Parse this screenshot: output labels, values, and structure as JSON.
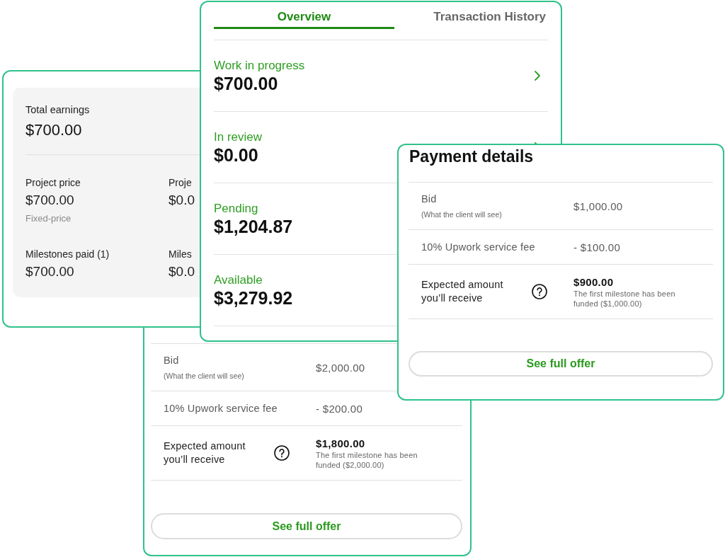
{
  "balance_card": {
    "tabs": [
      {
        "label": "Overview",
        "selected": true
      },
      {
        "label": "Transaction History",
        "selected": false
      }
    ],
    "rows": [
      {
        "label": "Work in progress",
        "amount": "$700.00"
      },
      {
        "label": "In review",
        "amount": "$0.00"
      },
      {
        "label": "Pending",
        "amount": "$1,204.87"
      },
      {
        "label": "Available",
        "amount": "$3,279.92"
      }
    ]
  },
  "earnings_card": {
    "total_label": "Total earnings",
    "total_amount": "$700.00",
    "stats": [
      {
        "label": "Project price",
        "amount": "$700.00",
        "note": "Fixed-price"
      },
      {
        "label": "Proje",
        "amount": "$0.0"
      },
      {
        "label": "Milestones paid (1)",
        "amount": "$700.00"
      },
      {
        "label": "Miles",
        "amount": "$0.0"
      }
    ]
  },
  "offer_cards": [
    {
      "title": "Payment details",
      "rows": [
        {
          "kind": "bid",
          "label": "Bid",
          "sublabel": "(What the client will see)",
          "value": "$1,000.00"
        },
        {
          "kind": "fee",
          "label": "10% Upwork service fee",
          "value": "- $100.00"
        },
        {
          "kind": "expected",
          "label": "Expected amount you’ll receive",
          "value": "$900.00",
          "note": "The first milestone has been funded ($1,000.00)"
        }
      ],
      "button": "See full offer"
    },
    {
      "rows": [
        {
          "kind": "bid",
          "label": "Bid",
          "sublabel": "(What the client will see)",
          "value": "$2,000.00"
        },
        {
          "kind": "fee",
          "label": "10% Upwork service fee",
          "value": "- $200.00"
        },
        {
          "kind": "expected",
          "label": "Expected amount you’ll receive",
          "value": "$1,800.00",
          "note": "The first milestone has been funded ($2,000.00)"
        }
      ],
      "button": "See full offer"
    }
  ]
}
